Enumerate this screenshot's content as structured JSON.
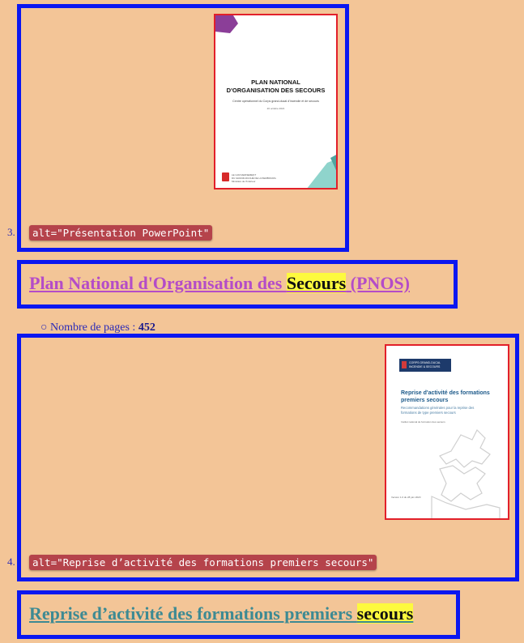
{
  "items": [
    {
      "number": "3.",
      "alt_text": "alt=\"Présentation PowerPoint\"",
      "cover": {
        "title_line1": "PLAN NATIONAL",
        "title_line2": "D'ORGANISATION DES SECOURS",
        "subtitle": "Centre opérationnel du Corps grand-ducal d'incendie et de secours",
        "date": "20 octobre 2021",
        "footer_line1": "LE GOUVERNEMENT",
        "footer_line2": "DU GRAND-DUCHÉ DE LUXEMBOURG",
        "footer_line3": "Ministère de l'Intérieur"
      },
      "link_text_before": "Plan National d'Organisation des ",
      "link_highlight": "Secours",
      "link_text_after": " (PNOS)",
      "link_color": "#b44cc8",
      "pages_label": "Nombre de pages : ",
      "pages_value": "452"
    },
    {
      "number": "4.",
      "alt_text": "alt=\"Reprise d’activité des formations premiers secours\"",
      "cover": {
        "badge_line1": "CORPS GRAND-DUCAL",
        "badge_line2": "INCENDIE & SECOURS",
        "title_line1": "Reprise d'activité des formations",
        "title_line2": "premiers secours",
        "subtitle_line1": "Recommandations générales pour la reprise des",
        "subtitle_line2": "formations de type premiers secours",
        "author": "Institut national de formation des secours",
        "version": "Version 1.0 du 28 juin 2020"
      },
      "link_text_before": "Reprise d’activité des formations premiers ",
      "link_highlight": "secours",
      "link_color": "#3d8a93"
    }
  ]
}
